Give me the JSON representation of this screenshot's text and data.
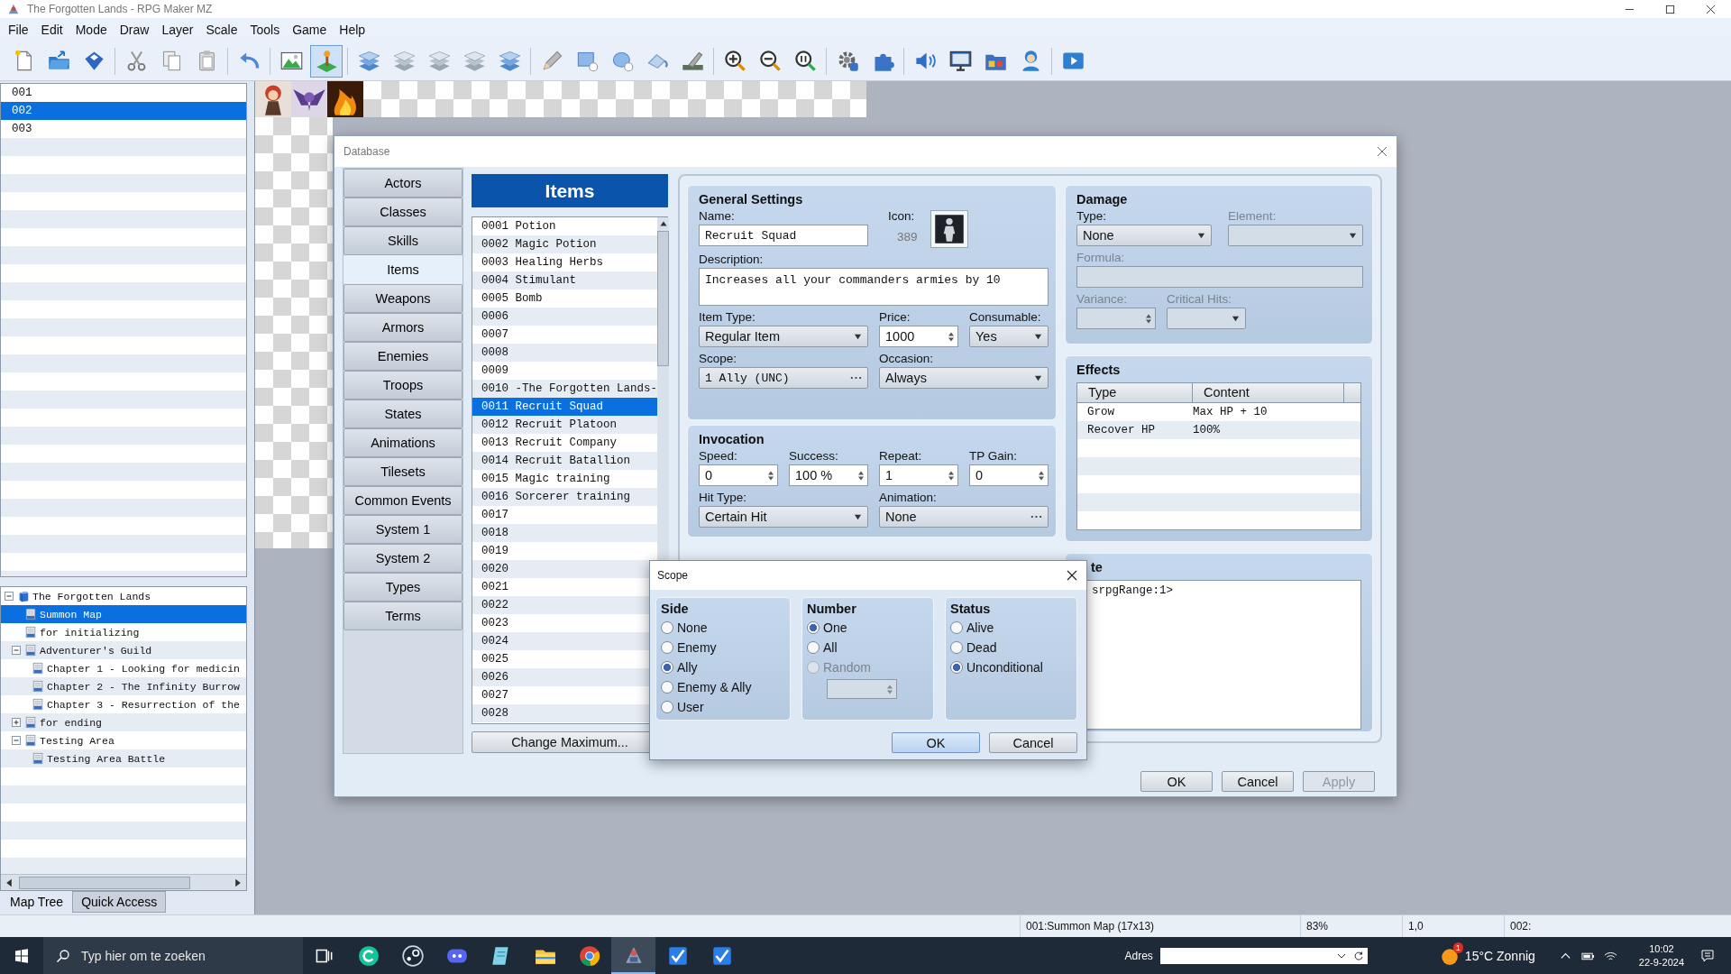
{
  "window": {
    "title": "The Forgotten Lands - RPG Maker MZ"
  },
  "menu": [
    "File",
    "Edit",
    "Mode",
    "Draw",
    "Layer",
    "Scale",
    "Tools",
    "Game",
    "Help"
  ],
  "mode_buttons": [
    {
      "selected": false
    },
    {
      "selected": true
    }
  ],
  "map_list": [
    {
      "label": "001",
      "selected": false
    },
    {
      "label": "002",
      "selected": true
    },
    {
      "label": "003",
      "selected": false
    }
  ],
  "map_tree": [
    {
      "label": "The Forgotten Lands",
      "kind": "project",
      "expanded": true,
      "selected": false,
      "children": [
        {
          "label": "Summon Map",
          "kind": "map",
          "selected": true
        },
        {
          "label": "for initializing",
          "kind": "map",
          "selected": false
        },
        {
          "label": "Adventurer's Guild",
          "kind": "map",
          "expanded": true,
          "selected": false,
          "children": [
            {
              "label": "Chapter 1 - Looking for medicin",
              "kind": "map",
              "selected": false
            },
            {
              "label": "Chapter 2 - The Infinity Burrow",
              "kind": "map",
              "selected": false
            },
            {
              "label": "Chapter 3 - Resurrection of the",
              "kind": "map",
              "selected": false
            }
          ]
        },
        {
          "label": "for ending",
          "kind": "map",
          "expanded": false,
          "selected": false
        },
        {
          "label": "Testing Area",
          "kind": "map",
          "expanded": true,
          "selected": false,
          "children": [
            {
              "label": "Testing Area Battle",
              "kind": "map",
              "selected": false
            }
          ]
        }
      ]
    }
  ],
  "tree_tabs": [
    {
      "label": "Map Tree",
      "selected": true
    },
    {
      "label": "Quick Access",
      "selected": false
    }
  ],
  "database": {
    "title": "Database",
    "categories": [
      {
        "label": "Actors",
        "selected": false
      },
      {
        "label": "Classes",
        "selected": false
      },
      {
        "label": "Skills",
        "selected": false
      },
      {
        "label": "Items",
        "selected": true
      },
      {
        "label": "Weapons",
        "selected": false
      },
      {
        "label": "Armors",
        "selected": false
      },
      {
        "label": "Enemies",
        "selected": false
      },
      {
        "label": "Troops",
        "selected": false
      },
      {
        "label": "States",
        "selected": false
      },
      {
        "label": "Animations",
        "selected": false
      },
      {
        "label": "Tilesets",
        "selected": false
      },
      {
        "label": "Common Events",
        "selected": false
      },
      {
        "label": "System 1",
        "selected": false
      },
      {
        "label": "System 2",
        "selected": false
      },
      {
        "label": "Types",
        "selected": false
      },
      {
        "label": "Terms",
        "selected": false
      }
    ],
    "list_title": "Items",
    "items": [
      {
        "id": "0001",
        "name": "Potion",
        "selected": false
      },
      {
        "id": "0002",
        "name": "Magic Potion",
        "selected": false
      },
      {
        "id": "0003",
        "name": "Healing Herbs",
        "selected": false
      },
      {
        "id": "0004",
        "name": "Stimulant",
        "selected": false
      },
      {
        "id": "0005",
        "name": "Bomb",
        "selected": false
      },
      {
        "id": "0006",
        "selected": false
      },
      {
        "id": "0007",
        "selected": false
      },
      {
        "id": "0008",
        "selected": false
      },
      {
        "id": "0009",
        "selected": false
      },
      {
        "id": "0010",
        "name": "-The Forgotten Lands-",
        "selected": false
      },
      {
        "id": "0011",
        "name": "Recruit Squad",
        "selected": true
      },
      {
        "id": "0012",
        "name": "Recruit Platoon",
        "selected": false
      },
      {
        "id": "0013",
        "name": "Recruit Company",
        "selected": false
      },
      {
        "id": "0014",
        "name": "Recruit Batallion",
        "selected": false
      },
      {
        "id": "0015",
        "name": "Magic training",
        "selected": false
      },
      {
        "id": "0016",
        "name": "Sorcerer training",
        "selected": false
      },
      {
        "id": "0017",
        "selected": false
      },
      {
        "id": "0018",
        "selected": false
      },
      {
        "id": "0019",
        "selected": false
      },
      {
        "id": "0020",
        "selected": false
      },
      {
        "id": "0021",
        "selected": false
      },
      {
        "id": "0022",
        "selected": false
      },
      {
        "id": "0023",
        "selected": false
      },
      {
        "id": "0024",
        "selected": false
      },
      {
        "id": "0025",
        "selected": false
      },
      {
        "id": "0026",
        "selected": false
      },
      {
        "id": "0027",
        "selected": false
      },
      {
        "id": "0028",
        "selected": false
      }
    ],
    "change_max_button": "Change Maximum...",
    "general": {
      "title": "General Settings",
      "name": {
        "label": "Name:",
        "value": "Recruit Squad"
      },
      "icon": {
        "label": "Icon:",
        "index": "389"
      },
      "description": {
        "label": "Description:",
        "value": "Increases all your commanders armies by 10"
      },
      "item_type": {
        "label": "Item Type:",
        "value": "Regular Item"
      },
      "price": {
        "label": "Price:",
        "value": "1000"
      },
      "consumable": {
        "label": "Consumable:",
        "value": "Yes"
      },
      "scope": {
        "label": "Scope:",
        "value": "1 Ally (UNC)"
      },
      "occasion": {
        "label": "Occasion:",
        "value": "Always"
      }
    },
    "invocation": {
      "title": "Invocation",
      "spins": [
        {
          "label": "Speed:",
          "value": "0"
        },
        {
          "label": "Success:",
          "value": "100 %"
        },
        {
          "label": "Repeat:",
          "value": "1"
        },
        {
          "label": "TP Gain:",
          "value": "0"
        }
      ],
      "hit_type": {
        "label": "Hit Type:",
        "value": "Certain Hit"
      },
      "animation": {
        "label": "Animation:",
        "value": "None"
      }
    },
    "damage": {
      "title": "Damage",
      "type": {
        "label": "Type:",
        "value": "None",
        "disabled": false
      },
      "element": {
        "label": "Element:",
        "disabled": true
      },
      "formula": {
        "label": "Formula:",
        "disabled": true
      },
      "variance": {
        "label": "Variance:",
        "disabled": true
      },
      "critical_hits": {
        "label": "Critical Hits:",
        "disabled": true
      }
    },
    "effects": {
      "title": "Effects",
      "columns": [
        "Type",
        "Content"
      ],
      "rows": [
        [
          "Grow",
          "Max HP + 10"
        ],
        [
          "Recover HP",
          "100%"
        ]
      ]
    },
    "note": {
      "title": "te",
      "text": "srpgRange:1>"
    },
    "buttons": [
      {
        "label": "OK",
        "disabled": false
      },
      {
        "label": "Cancel",
        "disabled": false
      },
      {
        "label": "Apply",
        "disabled": true
      }
    ]
  },
  "scope_dialog": {
    "title": "Scope",
    "groups": [
      {
        "title": "Side",
        "options": [
          {
            "label": "None",
            "selected": false,
            "disabled": false
          },
          {
            "label": "Enemy",
            "selected": false,
            "disabled": false
          },
          {
            "label": "Ally",
            "selected": true,
            "disabled": false
          },
          {
            "label": "Enemy & Ally",
            "selected": false,
            "disabled": false
          },
          {
            "label": "User",
            "selected": false,
            "disabled": false
          }
        ]
      },
      {
        "title": "Number",
        "options": [
          {
            "label": "One",
            "selected": true,
            "disabled": false
          },
          {
            "label": "All",
            "selected": false,
            "disabled": false
          },
          {
            "label": "Random",
            "selected": false,
            "disabled": true
          }
        ],
        "spin": {
          "disabled": true
        }
      },
      {
        "title": "Status",
        "options": [
          {
            "label": "Alive",
            "selected": false,
            "disabled": false
          },
          {
            "label": "Dead",
            "selected": false,
            "disabled": false
          },
          {
            "label": "Unconditional",
            "selected": true,
            "disabled": false
          }
        ]
      }
    ],
    "buttons": [
      {
        "label": "OK",
        "default": true
      },
      {
        "label": "Cancel",
        "default": false
      }
    ]
  },
  "status_bar": [
    "001:Summon Map (17x13)",
    "83%",
    "1,0",
    "002:"
  ],
  "taskbar": {
    "search_placeholder": "Typ hier om te zoeken",
    "apps": [
      {
        "selected": false
      },
      {
        "selected": false
      },
      {
        "selected": false
      },
      {
        "selected": false
      },
      {
        "selected": false
      },
      {
        "selected": false
      },
      {
        "selected": true
      },
      {
        "selected": false
      },
      {
        "selected": false
      }
    ],
    "address_label": "Adres",
    "weather_badge": "1",
    "weather": "15°C Zonnig",
    "time": "10:02",
    "date": "22-9-2024"
  }
}
